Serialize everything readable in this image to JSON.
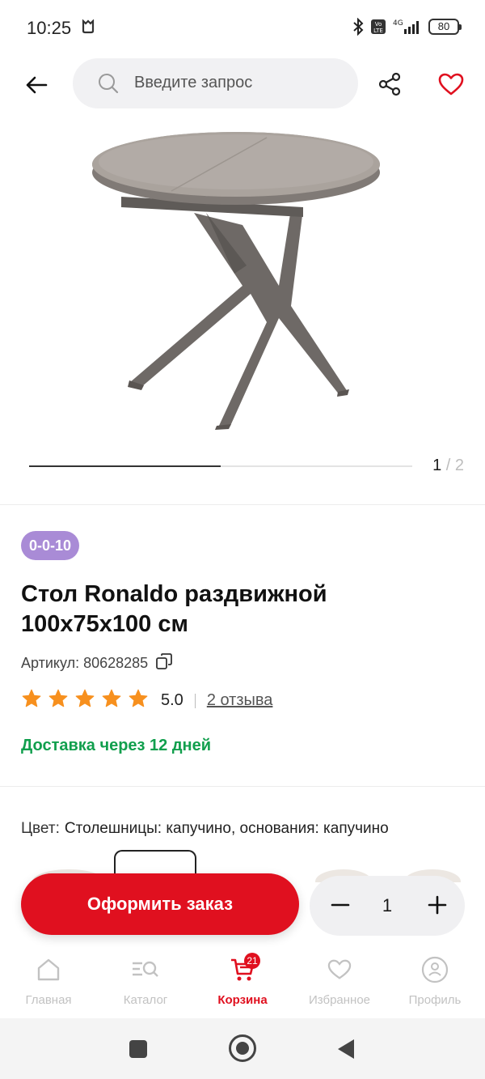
{
  "status": {
    "time": "10:25",
    "battery": "80"
  },
  "header": {
    "search_placeholder": "Введите запрос"
  },
  "gallery": {
    "current": "1",
    "separator": " / ",
    "total": "2",
    "progress": 0.5
  },
  "product": {
    "badge": "0-0-10",
    "title": "Стол Ronaldo раздвижной 100х75х100 см",
    "sku_label": "Артикул: 80628285",
    "rating": "5.0",
    "stars": 5,
    "reviews": "2 отзыва",
    "delivery": "Доставка через 12 дней",
    "color_label": "Цвет:",
    "color_value": "Столешницы: капучино, основания: капучино"
  },
  "actions": {
    "order_label": "Оформить заказ",
    "quantity": "1"
  },
  "nav": {
    "items": [
      {
        "label": "Главная",
        "icon": "home-icon"
      },
      {
        "label": "Каталог",
        "icon": "catalog-icon"
      },
      {
        "label": "Корзина",
        "icon": "cart-icon",
        "active": true,
        "badge": "21"
      },
      {
        "label": "Избранное",
        "icon": "heart-icon"
      },
      {
        "label": "Профиль",
        "icon": "profile-icon"
      }
    ]
  },
  "colors": {
    "accent": "#e0101f",
    "delivery": "#119f4d",
    "badge": "#a98bd6"
  }
}
